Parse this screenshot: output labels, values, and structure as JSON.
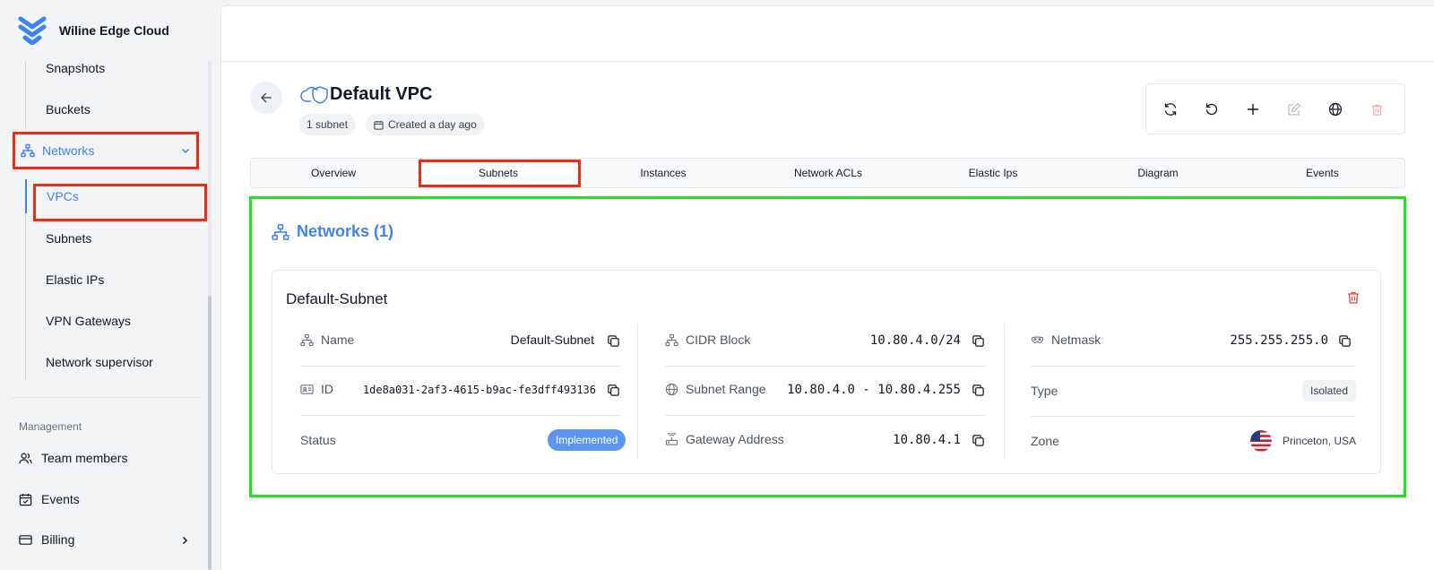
{
  "app": {
    "name": "Wiline Edge Cloud"
  },
  "sidebar": {
    "sub_items_top": [
      "Snapshots",
      "Buckets"
    ],
    "networks": {
      "label": "Networks"
    },
    "vpcs": {
      "label": "VPCs"
    },
    "sub_items_bottom": [
      "Subnets",
      "Elastic IPs",
      "VPN Gateways",
      "Network supervisor"
    ],
    "section_label": "Management",
    "main_items": [
      {
        "label": "Team members",
        "icon": "users-icon"
      },
      {
        "label": "Events",
        "icon": "calendar-check-icon"
      },
      {
        "label": "Billing",
        "icon": "credit-card-icon"
      }
    ]
  },
  "header": {
    "title": "Default VPC",
    "chips": [
      "1 subnet",
      "Created a day ago"
    ],
    "actions": [
      "refresh-icon",
      "reset-icon",
      "plus-icon",
      "edit-icon",
      "globe-icon",
      "trash-icon"
    ]
  },
  "tabs": [
    "Overview",
    "Subnets",
    "Instances",
    "Network ACLs",
    "Elastic Ips",
    "Diagram",
    "Events"
  ],
  "active_tab": "Subnets",
  "section": {
    "title": "Networks (1)"
  },
  "subnet": {
    "title": "Default-Subnet",
    "fields": {
      "name": {
        "label": "Name",
        "value": "Default-Subnet"
      },
      "id": {
        "label": "ID",
        "value": "1de8a031-2af3-4615-b9ac-fe3dff493136"
      },
      "status": {
        "label": "Status",
        "value": "Implemented"
      },
      "cidr": {
        "label": "CIDR Block",
        "value": "10.80.4.0/24"
      },
      "range": {
        "label": "Subnet Range",
        "value": "10.80.4.0 - 10.80.4.255"
      },
      "gateway": {
        "label": "Gateway Address",
        "value": "10.80.4.1"
      },
      "netmask": {
        "label": "Netmask",
        "value": "255.255.255.0"
      },
      "type": {
        "label": "Type",
        "value": "Isolated"
      },
      "zone": {
        "label": "Zone",
        "value": "Princeton, USA"
      }
    }
  },
  "colors": {
    "accent": "#3b82f6",
    "danger": "#ef4444",
    "highlight_red": "#ef2b14",
    "highlight_green": "#22e022"
  }
}
